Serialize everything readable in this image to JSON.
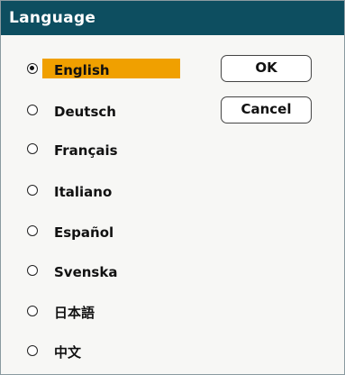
{
  "dialog": {
    "title": "Language"
  },
  "languages": [
    {
      "label": "English",
      "selected": true
    },
    {
      "label": "Deutsch",
      "selected": false
    },
    {
      "label": "Français",
      "selected": false
    },
    {
      "label": "Italiano",
      "selected": false
    },
    {
      "label": "Español",
      "selected": false
    },
    {
      "label": "Svenska",
      "selected": false
    },
    {
      "label": "日本語",
      "selected": false
    },
    {
      "label": "中文",
      "selected": false
    }
  ],
  "buttons": {
    "ok_label": "OK",
    "cancel_label": "Cancel"
  },
  "colors": {
    "titlebar": "#0d4e60",
    "highlight": "#f0a000",
    "background": "#f7f7f5"
  }
}
